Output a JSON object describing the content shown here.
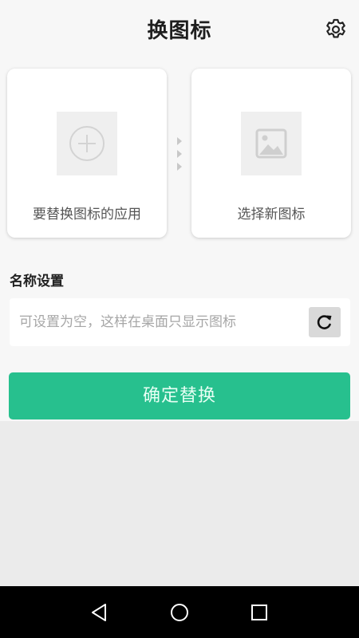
{
  "header": {
    "title": "换图标",
    "settings_icon": "gear-icon"
  },
  "cards": {
    "source": {
      "label": "要替换图标的应用",
      "icon": "plus-circle-icon"
    },
    "target": {
      "label": "选择新图标",
      "icon": "image-icon"
    },
    "arrows_icon": "triangle-right-icon"
  },
  "name_setting": {
    "label": "名称设置",
    "placeholder": "可设置为空，这样在桌面只显示图标",
    "value": "",
    "reset_icon": "refresh-icon"
  },
  "confirm_button": {
    "label": "确定替换",
    "color": "#27c08e"
  },
  "navbar": {
    "back_icon": "back-icon",
    "home_icon": "home-icon",
    "recents_icon": "recents-icon"
  }
}
